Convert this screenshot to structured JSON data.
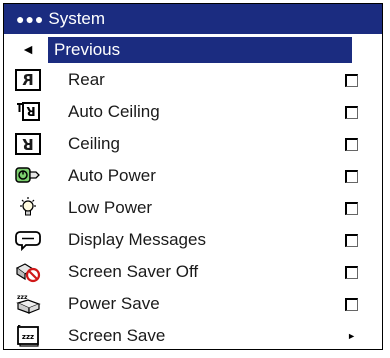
{
  "menu": {
    "title": "System",
    "title_dots": "●●●",
    "previous": {
      "label": "Previous",
      "icon": "left-triangle-icon",
      "arrow_glyph": "◄"
    },
    "items": [
      {
        "label": "Rear",
        "icon": "rear-projection-icon",
        "glyph": "R",
        "control": "checkbox",
        "checked": false
      },
      {
        "label": "Auto Ceiling",
        "icon": "auto-ceiling-icon",
        "glyph": "R",
        "control": "checkbox",
        "checked": false
      },
      {
        "label": "Ceiling",
        "icon": "ceiling-projection-icon",
        "glyph": "R",
        "control": "checkbox",
        "checked": false
      },
      {
        "label": "Auto Power",
        "icon": "auto-power-icon",
        "control": "checkbox",
        "checked": false
      },
      {
        "label": "Low Power",
        "icon": "low-power-bulb-icon",
        "control": "checkbox",
        "checked": false
      },
      {
        "label": "Display Messages",
        "icon": "speech-bubble-icon",
        "control": "checkbox",
        "checked": false
      },
      {
        "label": "Screen Saver Off",
        "icon": "screen-saver-off-icon",
        "control": "checkbox",
        "checked": false
      },
      {
        "label": "Power Save",
        "icon": "power-save-icon",
        "control": "checkbox",
        "checked": false
      },
      {
        "label": "Screen Save",
        "icon": "screen-save-icon",
        "control": "submenu",
        "arrow_glyph": "►"
      }
    ]
  },
  "colors": {
    "highlight": "#1b2c80",
    "text": "#1a1a1a",
    "background": "#ffffff"
  }
}
